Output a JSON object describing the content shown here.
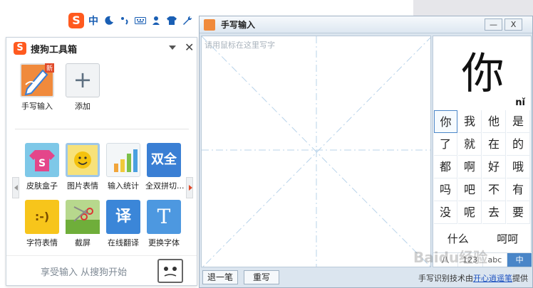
{
  "statusbar": {
    "logo": "S",
    "mode": "中",
    "icons": [
      "moon-icon",
      "punctuation-icon",
      "keyboard-icon",
      "user-icon",
      "skin-shirt-icon",
      "wrench-icon"
    ]
  },
  "toolbox": {
    "title": "搜狗工具箱",
    "logo": "S",
    "top_tools": [
      {
        "label": "手写输入",
        "icon": "handwrite-icon",
        "badge": "新"
      },
      {
        "label": "添加",
        "icon": "plus-icon"
      }
    ],
    "tools": [
      {
        "label": "皮肤盒子",
        "icon": "skin-box-icon"
      },
      {
        "label": "图片表情",
        "icon": "image-emoji-icon"
      },
      {
        "label": "输入统计",
        "icon": "bar-chart-icon"
      },
      {
        "label": "全双拼切...",
        "icon": "pinyin-switch-icon",
        "glyph": "双全"
      },
      {
        "label": "字符表情",
        "icon": "text-emoji-icon",
        "glyph": ":-)"
      },
      {
        "label": "截屏",
        "icon": "screenshot-icon"
      },
      {
        "label": "在线翻译",
        "icon": "translate-icon",
        "glyph": "译"
      },
      {
        "label": "更换字体",
        "icon": "font-icon",
        "glyph": "T"
      }
    ],
    "footer": "享受输入 从搜狗开始"
  },
  "handwriting": {
    "title": "手写输入",
    "placeholder": "请用鼠标在这里写字",
    "recognized": "你",
    "pinyin": "nǐ",
    "candidates": [
      "你",
      "我",
      "他",
      "是",
      "了",
      "就",
      "在",
      "的",
      "都",
      "啊",
      "好",
      "哦",
      "吗",
      "吧",
      "不",
      "有",
      "没",
      "呢",
      "去",
      "要"
    ],
    "phrases": [
      "什么",
      "呵呵"
    ],
    "modes": [
      "八",
      "123",
      "abc",
      "中"
    ],
    "active_mode": "中",
    "undo_label": "退一笔",
    "rewrite_label": "重写",
    "credit_prefix": "手写识别技术由",
    "credit_link": "开心逍遥笔",
    "credit_suffix": "提供",
    "minimize": "—",
    "close": "X"
  },
  "watermark": "Baidu经验"
}
